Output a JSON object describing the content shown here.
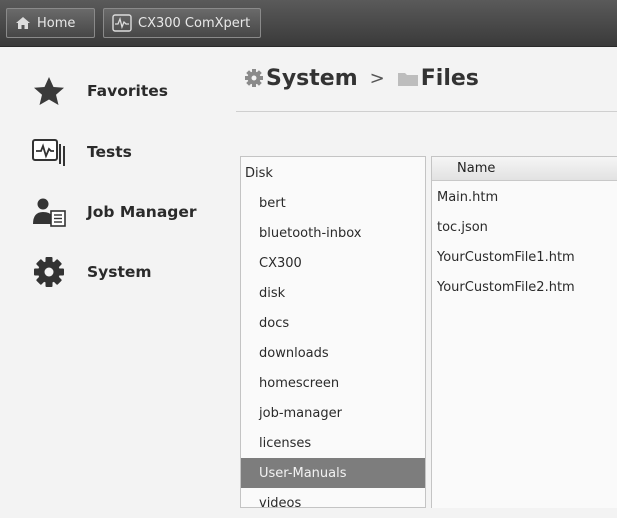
{
  "topbar": {
    "home_label": "Home",
    "app_label": "CX300 ComXpert"
  },
  "sidebar": {
    "items": [
      {
        "label": "Favorites",
        "icon": "star-icon"
      },
      {
        "label": "Tests",
        "icon": "tests-icon"
      },
      {
        "label": "Job Manager",
        "icon": "job-manager-icon"
      },
      {
        "label": "System",
        "icon": "gear-icon"
      }
    ]
  },
  "breadcrumb": {
    "parent": "System",
    "separator": ">",
    "current": "Files"
  },
  "tree": {
    "root": "Disk",
    "children": [
      "bert",
      "bluetooth-inbox",
      "CX300",
      "disk",
      "docs",
      "downloads",
      "homescreen",
      "job-manager",
      "licenses",
      "User-Manuals",
      "videos"
    ],
    "selected": "User-Manuals"
  },
  "files": {
    "column_header": "Name",
    "items": [
      "Main.htm",
      "toc.json",
      "YourCustomFile1.htm",
      "YourCustomFile2.htm"
    ]
  },
  "colors": {
    "topbar": "#4a4a4a",
    "selected_row": "#7d7d7d",
    "background": "#f3f3f3"
  }
}
